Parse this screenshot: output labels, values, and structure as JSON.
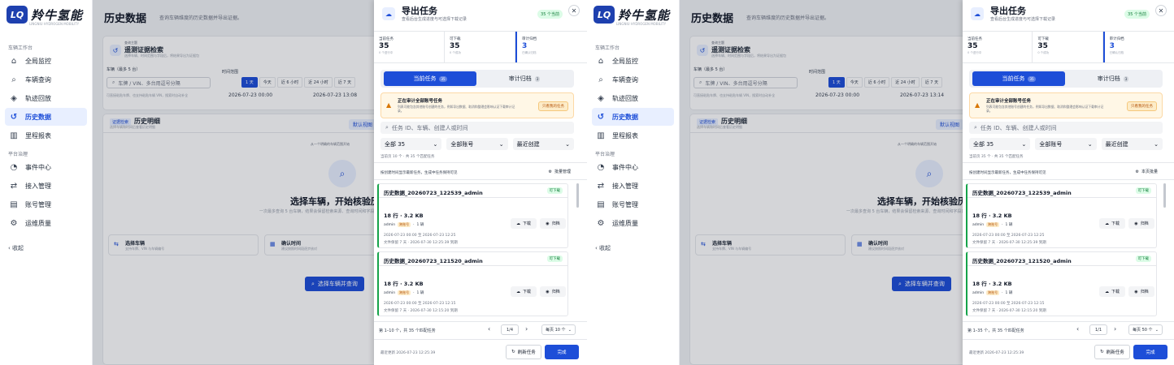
{
  "brand": {
    "name": "羚牛氢能",
    "mark": "LQ",
    "sub": "LINGNIU HYDROGEN MOBILITY"
  },
  "nav": {
    "group1": "车辆工作台",
    "group2": "平台治理",
    "collapse": "收起",
    "items": [
      {
        "label": "全局监控",
        "icon": "home-icon"
      },
      {
        "label": "车辆查询",
        "icon": "search-icon"
      },
      {
        "label": "轨迹回放",
        "icon": "route-icon"
      },
      {
        "label": "历史数据",
        "icon": "history-icon"
      },
      {
        "label": "里程报表",
        "icon": "bar-chart-icon"
      },
      {
        "label": "事件中心",
        "icon": "bell-icon"
      },
      {
        "label": "接入管理",
        "icon": "plug-icon"
      },
      {
        "label": "账号管理",
        "icon": "users-icon"
      },
      {
        "label": "运维质量",
        "icon": "gear-icon"
      }
    ]
  },
  "main": {
    "title": "历史数据",
    "desc": "查询车辆维度的历史数据并导出证据。",
    "search_card": {
      "tag": "查询主题",
      "title": "遥测证据检索",
      "desc": "选择车辆、时间范围与字段后，将结果导出为证据包",
      "vehicle_label": "车辆（最多 5 台）",
      "vehicle_placeholder": "车牌 / VIN、多台用逗号分隔",
      "vehicle_hint": "可直接粘贴车牌、也支持粘贴车辆 VIN，搜索时自动补全",
      "time_label": "时间范围",
      "ranges": [
        "1 天",
        "今天",
        "近 6 小时",
        "近 24 小时",
        "近 7 天"
      ],
      "start_a": "2026-07-23 00:00",
      "end_a": "2026-07-23 13:08",
      "start_b": "2026-07-23 00:00",
      "end_b": "2026-07-23 13:14"
    },
    "hist_card": {
      "tag": "证据检索",
      "title": "历史明细",
      "desc": "选择车辆和时间后查看历史明细",
      "btn": "默认视图",
      "empty_hint": "从一个明确的车辆范围开始",
      "empty_title": "选择车辆，开始核验历史记录",
      "empty_desc": "一次最多查询 5 台车辆，结果会保留检索来源、查询时间和字段口径。",
      "step1_title": "选择车辆",
      "step1_desc": "支持车牌、VIN 与车辆编号",
      "step2_title": "确认时间",
      "step2_desc": "建议按照时间段逐步核对",
      "cta": "选择车辆并查询"
    }
  },
  "drawer": {
    "title": "导出任务",
    "subtitle": "查看后台生成进度与可选择下载记录",
    "count": "35 个当前",
    "stats": [
      {
        "label": "当前任务",
        "value": "35",
        "sub": "0 个进行中"
      },
      {
        "label": "可下载",
        "value": "35",
        "sub": "0 个成功"
      },
      {
        "label": "审计归档",
        "value": "3",
        "sub": "已确认归档"
      }
    ],
    "tab_current": "当前任务",
    "tab_current_badge": "35",
    "tab_audit": "审计归档",
    "tab_audit_badge": "3",
    "warn_title": "正在审计全部账号任务",
    "warn_desc": "列表可能包含其他账号创建的任务，例如导出数据、取消和整理会影响认证下载审计记录。",
    "warn_btn": "只看我的任务",
    "search_placeholder": "任务 ID、车辆、创建人或时间",
    "filter_status": "全部 35",
    "filter_account": "全部账号",
    "filter_sort": "最近创建",
    "meta_a": "当前页 10 个 · 共 35 个匹配任务",
    "meta_b": "当前页 35 个 · 共 35 个匹配任务",
    "bulk_hint": "按创建时间显示最新任务，生成中任务保持可见",
    "bulk_btn_a": "批量管理",
    "bulk_btn_b": "本页批量",
    "tasks": [
      {
        "name": "历史数据_20260723_122539_admin",
        "status": "可下载",
        "rows": "18 行 · 3.2 KB",
        "user": "admin",
        "account": "跨账号",
        "vehicles": "1 辆",
        "range": "2026-07-23 00:00 至 2026-07-23 12:25",
        "keep": "文件保留 7 天 · 2026-07-30 12:25:39 到期",
        "download": "下载",
        "archive": "归档"
      },
      {
        "name": "历史数据_20260723_121520_admin",
        "status": "可下载",
        "rows": "18 行 · 3.2 KB",
        "user": "admin",
        "account": "跨账号",
        "vehicles": "1 辆",
        "range": "2026-07-23 00:00 至 2026-07-23 12:15",
        "keep": "文件保留 7 天 · 2026-07-30 12:15:20 到期",
        "download": "下载",
        "archive": "归档"
      }
    ],
    "pager_a": {
      "summary": "第 1–10 个，共 35 个匹配任务",
      "page": "1/4",
      "size": "每页 10 个"
    },
    "pager_b": {
      "summary": "第 1–35 个，共 35 个匹配任务",
      "page": "1/1",
      "size": "每页 50 个"
    },
    "footer_time": "最近更新 2026-07-23 12:25:39",
    "refresh": "刷新任务",
    "done": "完成"
  },
  "colors": {
    "accent": "#1d4ed8",
    "success": "#16a34a",
    "warning": "#d97706"
  }
}
